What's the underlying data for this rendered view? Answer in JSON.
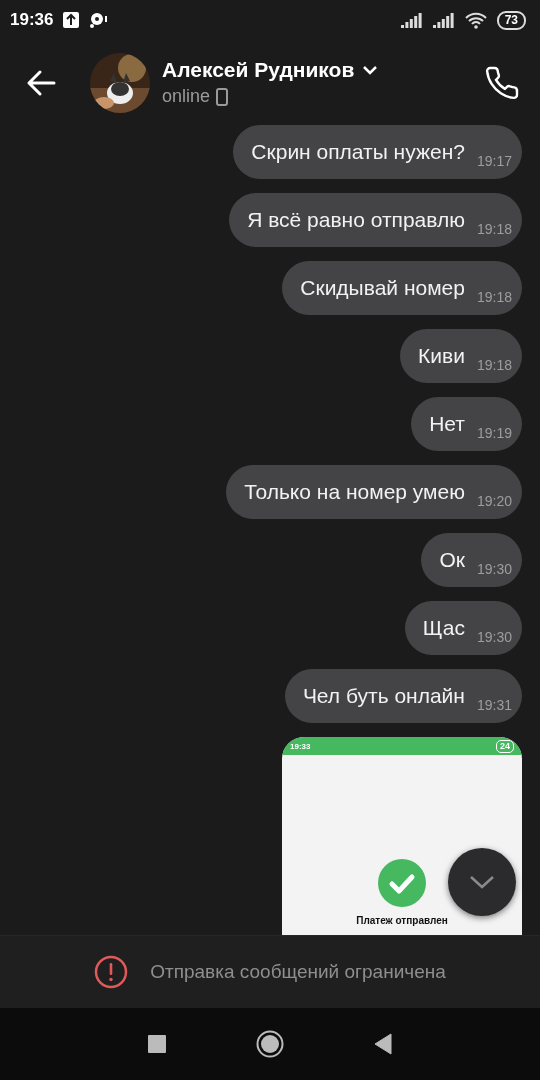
{
  "status_bar": {
    "time": "19:36",
    "battery": "73"
  },
  "header": {
    "name": "Алексей Рудников",
    "status": "online"
  },
  "messages": [
    {
      "text": "Скрин оплаты нужен?",
      "time": "19:17"
    },
    {
      "text": "Я всё равно отправлю",
      "time": "19:18"
    },
    {
      "text": "Скидывай номер",
      "time": "19:18"
    },
    {
      "text": "Киви",
      "time": "19:18"
    },
    {
      "text": "Нет",
      "time": "19:19"
    },
    {
      "text": "Только на номер умею",
      "time": "19:20"
    },
    {
      "text": "Ок",
      "time": "19:30"
    },
    {
      "text": "Щас",
      "time": "19:30"
    },
    {
      "text": "Чел буть онлайн",
      "time": "19:31"
    }
  ],
  "image_message": {
    "status_time": "19:33",
    "battery": "24",
    "caption": "Платеж отправлен"
  },
  "restriction_notice": {
    "text": "Отправка сообщений ограничена"
  }
}
